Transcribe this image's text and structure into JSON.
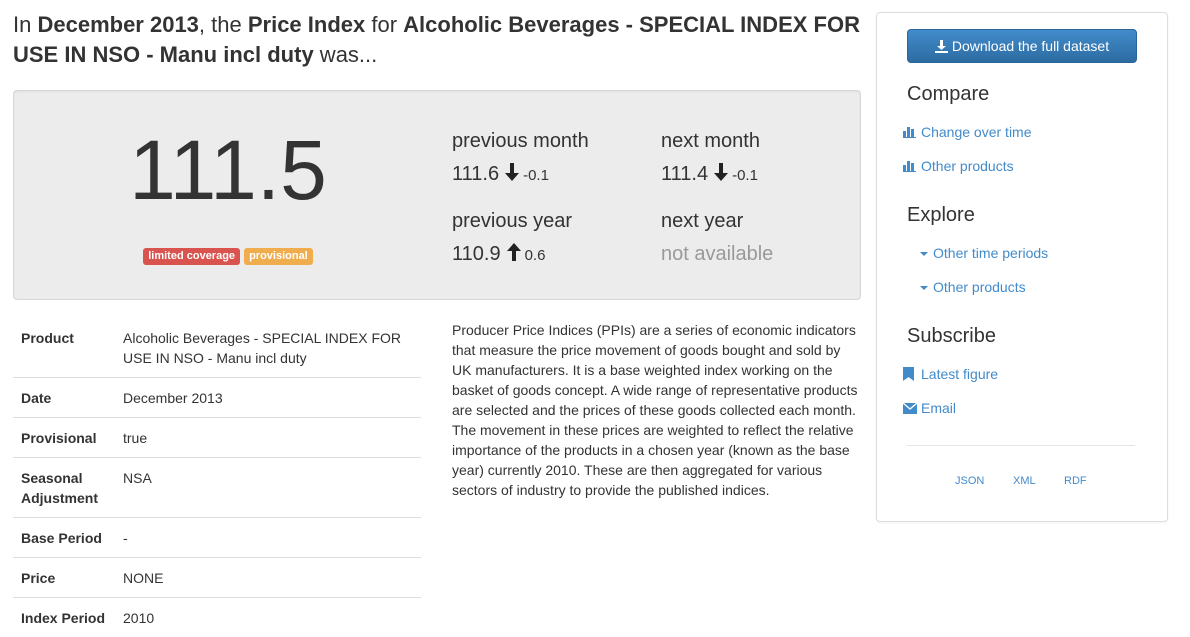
{
  "headline": {
    "prefix": "In ",
    "date": "December 2013",
    "mid1": ", the ",
    "index": "Price Index",
    "mid2": " for ",
    "product": "Alcoholic Beverages - SPECIAL INDEX FOR USE IN NSO - Manu incl duty",
    "suffix": " was..."
  },
  "main_value": "111.5",
  "badges": {
    "coverage": "limited coverage",
    "status": "provisional"
  },
  "comparisons": {
    "previous_month": {
      "label": "previous month",
      "value": "111.6",
      "direction": "down",
      "diff": "-0.1"
    },
    "next_month": {
      "label": "next month",
      "value": "111.4",
      "direction": "down",
      "diff": "-0.1"
    },
    "previous_year": {
      "label": "previous year",
      "value": "110.9",
      "direction": "up",
      "diff": "0.6"
    },
    "next_year": {
      "label": "next year",
      "value": "not available"
    }
  },
  "details": [
    {
      "key": "Product",
      "value": "Alcoholic Beverages - SPECIAL INDEX FOR USE IN NSO - Manu incl duty"
    },
    {
      "key": "Date",
      "value": "December 2013"
    },
    {
      "key": "Provisional",
      "value": "true"
    },
    {
      "key": "Seasonal Adjustment",
      "value": "NSA"
    },
    {
      "key": "Base Period",
      "value": "-"
    },
    {
      "key": "Price",
      "value": "NONE"
    },
    {
      "key": "Index Period",
      "value": "2010"
    }
  ],
  "description": "Producer Price Indices (PPIs) are a series of economic indicators that measure the price movement of goods bought and sold by UK manufacturers. It is a base weighted index working on the basket of goods concept. A wide range of representative products are selected and the prices of these goods collected each month. The movement in these prices are weighted to reflect the relative importance of the products in a chosen year (known as the base year) currently 2010. These are then aggregated for various sectors of industry to provide the published indices.",
  "sidebar": {
    "download_label": "Download the full dataset",
    "compare": {
      "title": "Compare",
      "links": [
        "Change over time",
        "Other products"
      ]
    },
    "explore": {
      "title": "Explore",
      "links": [
        "Other time periods",
        "Other products"
      ]
    },
    "subscribe": {
      "title": "Subscribe",
      "links": [
        "Latest figure",
        "Email"
      ]
    },
    "formats": [
      "JSON",
      "XML",
      "RDF"
    ]
  },
  "colors": {
    "link": "#428bca",
    "button": "#2f72b9",
    "badge_red": "#d9534f",
    "badge_orange": "#f0ad4e",
    "panel": "#ececec"
  },
  "icons": [
    "download-icon",
    "bar-chart-icon",
    "caret-down-icon",
    "bookmark-icon",
    "envelope-icon",
    "arrow-down-icon",
    "arrow-up-icon"
  ]
}
